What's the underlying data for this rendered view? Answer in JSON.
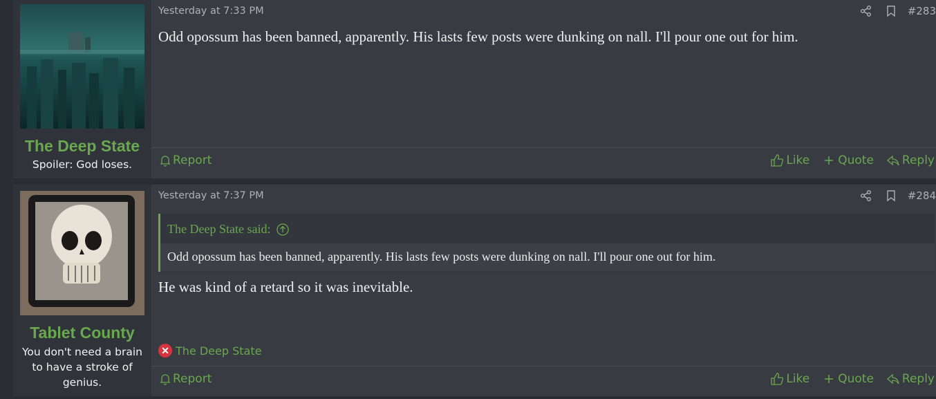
{
  "posts": [
    {
      "author": "The Deep State",
      "user_title": "Spoiler: God loses.",
      "avatar": "underwater-city-avatar",
      "timestamp": "Yesterday at 7:33 PM",
      "post_number": "#283",
      "body": "Odd opossum has been banned, apparently. His lasts few posts were dunking on nall. I'll pour one out for him.",
      "actions": {
        "report": "Report",
        "like": "Like",
        "quote": "Quote",
        "reply": "Reply"
      }
    },
    {
      "author": "Tablet County",
      "user_title": "You don't need a brain to have a stroke of genius.",
      "avatar": "skull-tablet-avatar",
      "timestamp": "Yesterday at 7:37 PM",
      "post_number": "#284",
      "quote": {
        "author_label": "The Deep State said:",
        "text": "Odd opossum has been banned, apparently. His lasts few posts were dunking on nall. I'll pour one out for him."
      },
      "body": "He was kind of a retard so it was inevitable.",
      "reaction": {
        "icon": "x-icon",
        "user": "The Deep State",
        "color": "#d9333f"
      },
      "actions": {
        "report": "Report",
        "like": "Like",
        "quote": "Quote",
        "reply": "Reply"
      }
    }
  ],
  "colors": {
    "accent": "#6aa84f",
    "post_bg": "#383b42",
    "author_bg": "#30333a",
    "page_bg": "#2a2d33"
  }
}
